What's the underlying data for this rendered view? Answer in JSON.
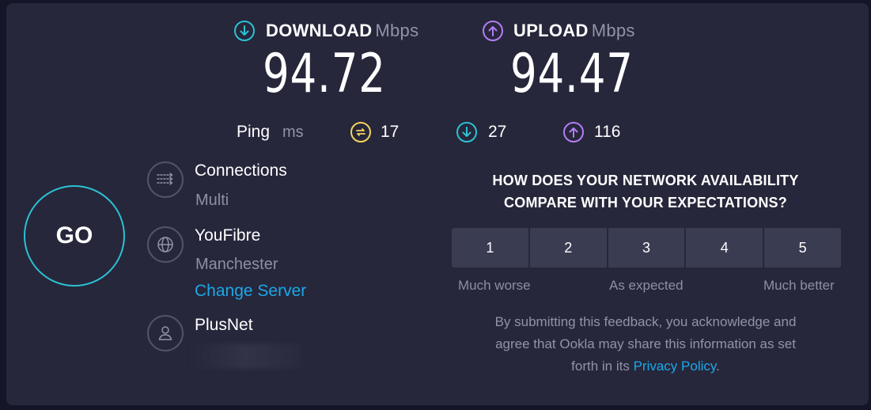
{
  "download": {
    "title": "DOWNLOAD",
    "unit": "Mbps",
    "value": "94.72",
    "icon": "download-arrow-icon",
    "color": "#2cc1d4"
  },
  "upload": {
    "title": "UPLOAD",
    "unit": "Mbps",
    "value": "94.47",
    "icon": "upload-arrow-icon",
    "color": "#b57cf5"
  },
  "ping": {
    "label": "Ping",
    "unit": "ms",
    "idle": "17",
    "download": "27",
    "upload": "116",
    "idle_color": "#f4d35e"
  },
  "go_label": "GO",
  "connections": {
    "title": "Connections",
    "value": "Multi"
  },
  "server": {
    "name": "YouFibre",
    "location": "Manchester",
    "change_label": "Change Server"
  },
  "provider": {
    "name": "PlusNet"
  },
  "feedback": {
    "question_line1": "HOW DOES YOUR NETWORK AVAILABILITY",
    "question_line2": "COMPARE WITH YOUR EXPECTATIONS?",
    "options": [
      "1",
      "2",
      "3",
      "4",
      "5"
    ],
    "low_label": "Much worse",
    "mid_label": "As expected",
    "high_label": "Much better",
    "disclaimer_line1": "By submitting this feedback, you acknowledge and",
    "disclaimer_line2": "agree that Ookla may share this information as set",
    "disclaimer_line3_pre": "forth in its",
    "privacy_link": "Privacy Policy",
    "disclaimer_line3_post": "."
  }
}
